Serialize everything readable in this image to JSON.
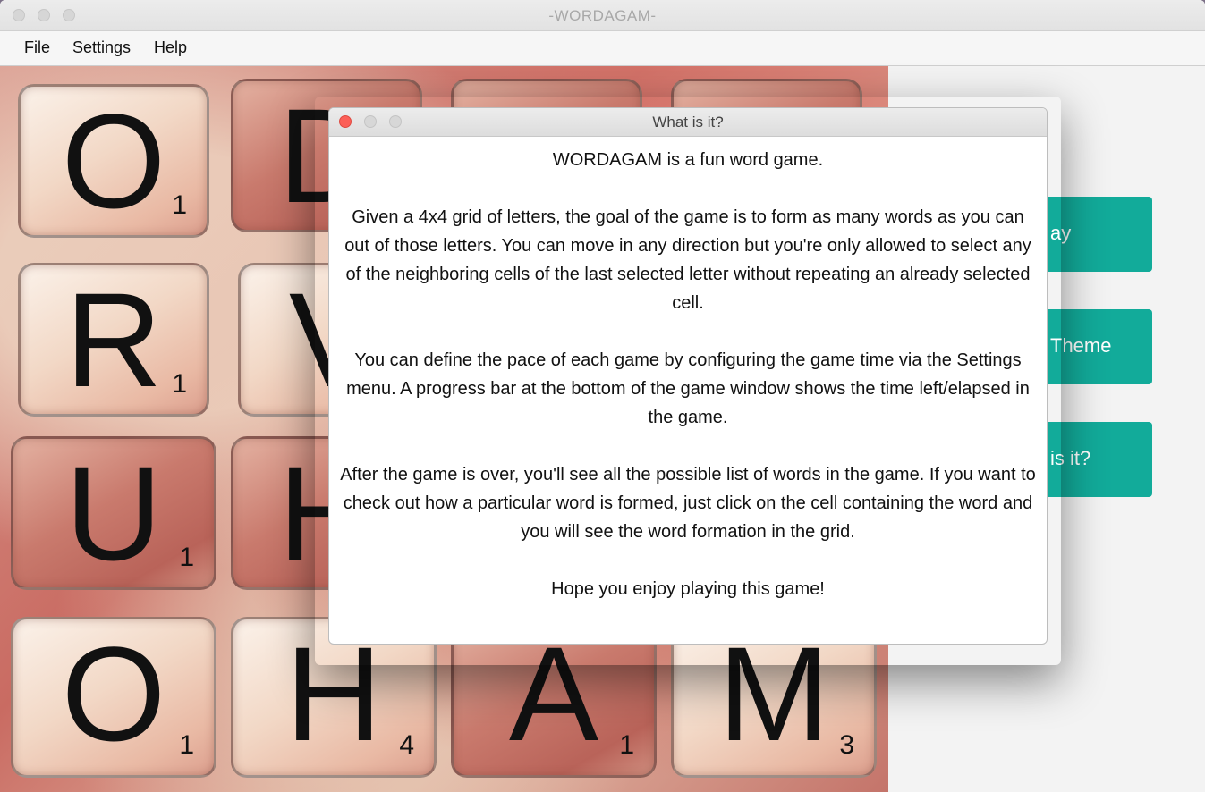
{
  "window": {
    "title": "-WORDAGAM-"
  },
  "menu": {
    "items": [
      {
        "label": "File"
      },
      {
        "label": "Settings"
      },
      {
        "label": "Help"
      }
    ]
  },
  "board": {
    "tiles": [
      {
        "letter": "O",
        "score": "1"
      },
      {
        "letter": "D",
        "score": ""
      },
      {
        "letter": "",
        "score": ""
      },
      {
        "letter": "",
        "score": ""
      },
      {
        "letter": "R",
        "score": "1"
      },
      {
        "letter": "V",
        "score": ""
      },
      {
        "letter": "",
        "score": ""
      },
      {
        "letter": "",
        "score": ""
      },
      {
        "letter": "U",
        "score": "1"
      },
      {
        "letter": "H",
        "score": ""
      },
      {
        "letter": "",
        "score": ""
      },
      {
        "letter": "",
        "score": ""
      },
      {
        "letter": "O",
        "score": "1"
      },
      {
        "letter": "H",
        "score": "4"
      },
      {
        "letter": "A",
        "score": "1"
      },
      {
        "letter": "M",
        "score": "3"
      }
    ]
  },
  "side_panel": {
    "buttons": [
      {
        "label": "ay"
      },
      {
        "label": "Theme"
      },
      {
        "label": "is it?"
      }
    ]
  },
  "dialog": {
    "title": "What is it?",
    "paragraphs": [
      "WORDAGAM is a fun word game.",
      "Given a 4x4 grid of letters, the goal of the game is to form as many words as you can out of those letters. You can move in any direction but you're only allowed to select any of the neighboring cells of the last selected letter without repeating an already selected cell.",
      "You can define the pace of each game by configuring the game time via the Settings menu. A progress bar at the bottom of the game window shows the time left/elapsed in the game.",
      "After the game is over, you'll see all the possible list of words in the game. If you want to check out how a particular word is formed, just click on the cell containing the word and you will see the word formation in the grid.",
      "Hope you enjoy playing this game!"
    ]
  }
}
